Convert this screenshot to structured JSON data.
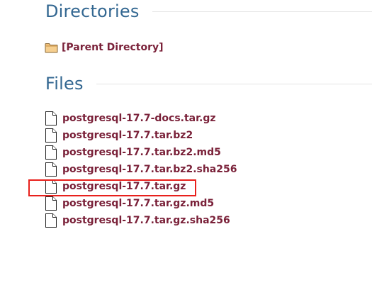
{
  "directories": {
    "title": "Directories",
    "parent_link": "[Parent Directory]"
  },
  "files": {
    "title": "Files",
    "items": [
      {
        "name": "postgresql-17.7-docs.tar.gz",
        "icon": "file-icon"
      },
      {
        "name": "postgresql-17.7.tar.bz2",
        "icon": "file-icon"
      },
      {
        "name": "postgresql-17.7.tar.bz2.md5",
        "icon": "file-icon"
      },
      {
        "name": "postgresql-17.7.tar.bz2.sha256",
        "icon": "file-icon"
      },
      {
        "name": "postgresql-17.7.tar.gz",
        "icon": "file-icon",
        "highlighted": true
      },
      {
        "name": "postgresql-17.7.tar.gz.md5",
        "icon": "file-icon"
      },
      {
        "name": "postgresql-17.7.tar.gz.sha256",
        "icon": "file-icon"
      }
    ]
  },
  "colors": {
    "heading": "#336791",
    "link": "#7a2139",
    "highlight_border": "#e8201c",
    "rule": "#e4e4e4"
  }
}
